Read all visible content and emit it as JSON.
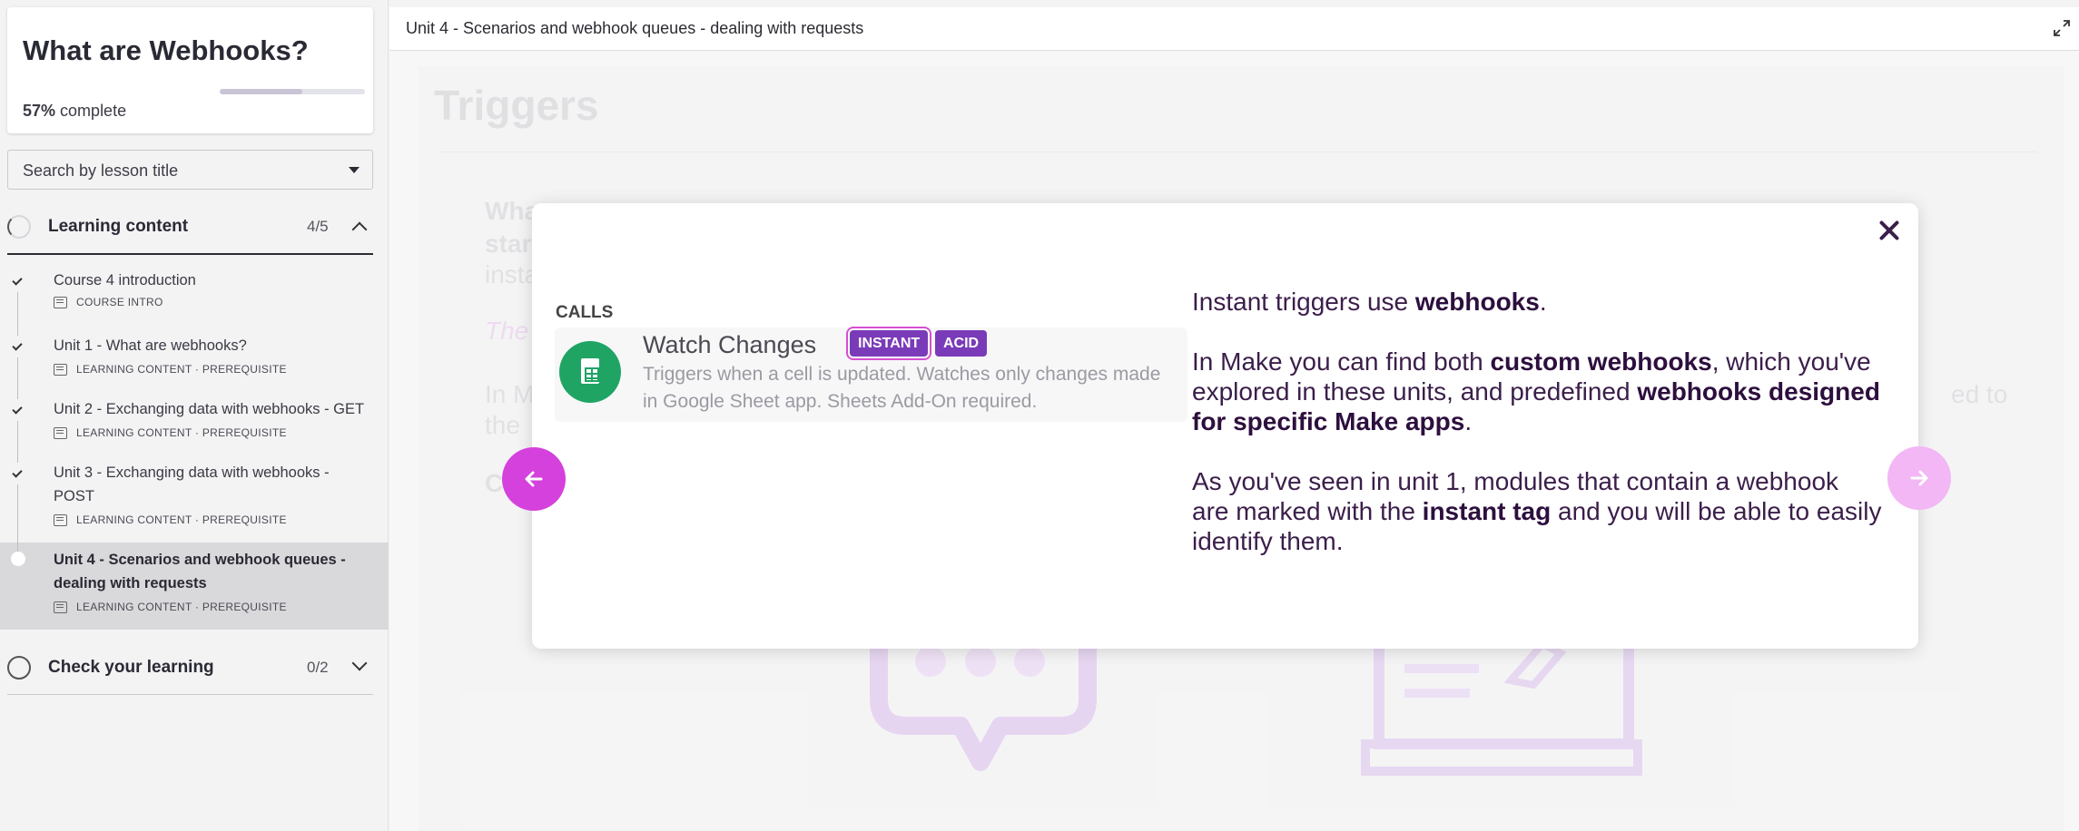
{
  "course": {
    "title": "What are Webhooks?",
    "progress_percent": "57%",
    "progress_suffix": "complete",
    "progress_value": 0.57
  },
  "search": {
    "label": "Search by lesson title"
  },
  "sections": [
    {
      "title": "Learning content",
      "count": "4/5",
      "lessons": [
        {
          "title": "Course 4 introduction",
          "meta": "COURSE INTRO"
        },
        {
          "title": "Unit 1 - What are webhooks?",
          "meta": "LEARNING CONTENT · PREREQUISITE"
        },
        {
          "title": "Unit 2 - Exchanging data with webhooks - GET",
          "meta": "LEARNING CONTENT · PREREQUISITE"
        },
        {
          "title": "Unit 3 - Exchanging data with webhooks - POST",
          "meta": "LEARNING CONTENT · PREREQUISITE"
        },
        {
          "title": "Unit 4 - Scenarios and webhook queues - dealing with requests",
          "meta": "LEARNING CONTENT · PREREQUISITE"
        }
      ]
    },
    {
      "title": "Check your learning",
      "count": "0/2"
    }
  ],
  "topbar": {
    "title": "Unit 4 - Scenarios and webhook queues - dealing with requests"
  },
  "content": {
    "heading": "Triggers",
    "ghost_lines": [
      "What",
      "star",
      "insta",
      "The",
      "In M",
      "the",
      "C",
      "ed to"
    ]
  },
  "modal": {
    "calls_label": "CALLS",
    "module": {
      "name": "Watch Changes",
      "badge_instant": "INSTANT",
      "badge_acid": "ACID",
      "description": "Triggers when a cell is updated. Watches only changes made in Google Sheet app. Sheets Add-On required."
    },
    "p1": {
      "a": "Instant triggers use ",
      "b": "webhooks",
      "c": "."
    },
    "p2": {
      "a": "In Make you can find both ",
      "b": "custom webhooks",
      "c": ", which you've explored in these units, and predefined ",
      "d": "webhooks designed for specific Make apps",
      "e": "."
    },
    "p3": {
      "a": "As you've seen in unit 1, modules that contain a webhook are marked with the ",
      "b": "instant tag",
      "c": " and you will be able to easily identify them."
    }
  },
  "colors": {
    "accent": "#d541dc",
    "accent_light": "#f2b7f4",
    "badge": "#7a3bb8",
    "text_dark": "#3b1e4a",
    "sheets_green": "#20a464"
  }
}
